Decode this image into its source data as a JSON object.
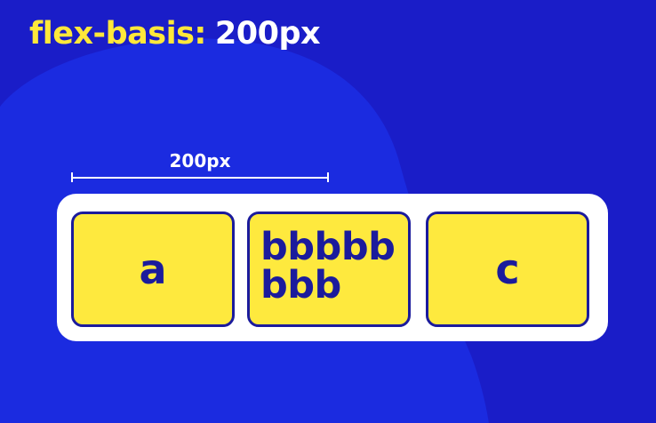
{
  "colors": {
    "background_blue": "#1A1DC8",
    "blob_blue": "#1B2BE0",
    "accent_yellow": "#FFE83A",
    "item_yellow": "#FEE93E",
    "item_border_navy": "#1B1B9C",
    "container_white": "#FFFFFF"
  },
  "title": {
    "property": "flex-basis",
    "colon": ":",
    "value": "200px"
  },
  "measurement": {
    "label": "200px"
  },
  "flex_items": [
    {
      "label": "a"
    },
    {
      "label": "bbbbbbbb"
    },
    {
      "label": "c"
    }
  ]
}
